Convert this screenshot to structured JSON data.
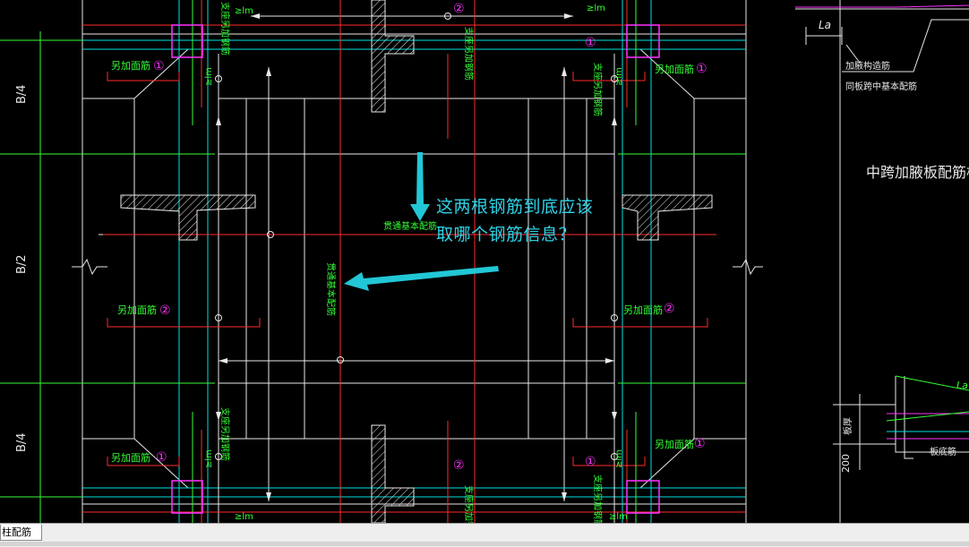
{
  "colors": {
    "background": "#000000",
    "green_text": "#33ff33",
    "red_line": "#ff2a2a",
    "cyan_line": "#00e0e0",
    "white_line": "#e8e8e8",
    "magenta_line": "#ff33ff",
    "annotation_arrow": "#22c7d6",
    "annotation_text": "#2fd2e6"
  },
  "drawing": {
    "dim_labels": [
      "B/4",
      "B/2",
      "B/4"
    ],
    "len_labels": [
      "≥lm",
      "≥lm",
      "≥lm",
      "≥lm",
      "≥lm",
      "≥lm",
      "≥lm",
      "≥lm"
    ],
    "extra_rebar": [
      "另加面筋",
      "另加面筋",
      "另加面筋",
      "另加面筋",
      "另加面筋",
      "另加面筋"
    ],
    "circle_labels": [
      "①",
      "①",
      "②",
      "②",
      "①",
      "①",
      "①",
      "②",
      "②",
      "①"
    ],
    "support_rebar": [
      "支座另加钢筋",
      "支座另加钢筋",
      "支座另加钢筋",
      "支座另加钢筋",
      "支座另加钢筋",
      "支座另加钢筋"
    ],
    "through_rebar_h": "贯通基本配筋",
    "through_rebar_v": "贯通基本配筋",
    "right_title": "中跨加腋板配筋构造",
    "right_la_top": "La",
    "right_label_1": "加腋构造筋",
    "right_label_2": "同板跨中基本配筋",
    "right_la_bottom": "La",
    "right_side_label": "板厚",
    "right_dim": "200",
    "right_bottom_label": "板底筋"
  },
  "annotation": {
    "line1": "这两根钢筋到底应该",
    "line2": "取哪个钢筋信息？"
  },
  "statusbar": {
    "tab_label": "柱配筋"
  }
}
